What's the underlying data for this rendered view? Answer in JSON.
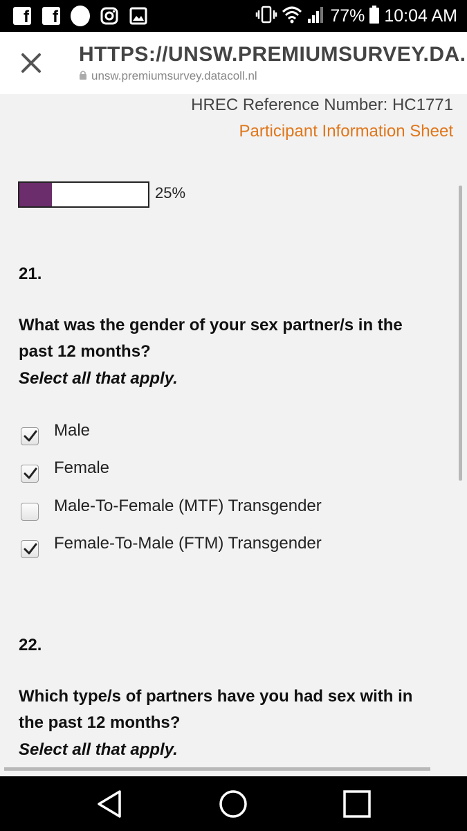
{
  "status_bar": {
    "battery": "77%",
    "time": "10:04 AM",
    "icons": [
      "facebook-icon",
      "facebook-icon",
      "circle-icon",
      "instagram-icon",
      "image-icon",
      "vibrate-icon",
      "wifi-icon",
      "signal-icon",
      "battery-icon"
    ]
  },
  "browser": {
    "title": "HTTPS://UNSW.PREMIUMSURVEY.DA...",
    "url": "unsw.premiumsurvey.datacoll.nl"
  },
  "header": {
    "hrec": "HREC Reference Number: HC1771",
    "info_link": "Participant Information Sheet"
  },
  "progress": {
    "value": 0.25,
    "label": "25%",
    "fill_color": "#6b2d6b"
  },
  "questions": [
    {
      "number": "21.",
      "text": "What was the gender of your sex partner/s in the past 12 months?",
      "hint": "Select all that apply.",
      "options": [
        {
          "label": "Male",
          "checked": true
        },
        {
          "label": "Female",
          "checked": true
        },
        {
          "label": "Male-To-Female (MTF) Transgender",
          "checked": false
        },
        {
          "label": "Female-To-Male (FTM) Transgender",
          "checked": true
        }
      ]
    },
    {
      "number": "22.",
      "text": "Which type/s of partners have you had sex with in the past 12 months?",
      "hint": "Select all that apply."
    }
  ],
  "colors": {
    "accent": "#e0761a",
    "background": "#f2f2f2"
  }
}
